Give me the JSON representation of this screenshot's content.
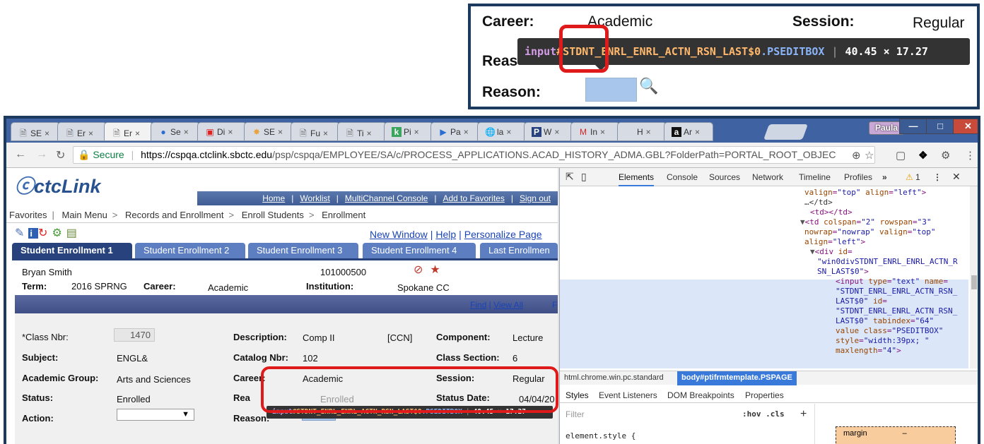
{
  "zoom": {
    "career_label": "Career:",
    "career_value": "Academic",
    "session_label": "Session:",
    "session_value": "Regular",
    "reason_label_top": "Reas",
    "reason_label": "Reason:",
    "tooltip": {
      "tag": "input",
      "id": "#STDNT_ENRL_ENRL_ACTN_RSN_LAST$0",
      "cls": ".PSEDITBOX",
      "size": "40.45 × 17.27"
    }
  },
  "browser": {
    "tabs": [
      {
        "icon": "page",
        "label": "SE"
      },
      {
        "icon": "page",
        "label": "Er"
      },
      {
        "icon": "page",
        "label": "Er"
      },
      {
        "icon": "blue-circle",
        "label": "Se"
      },
      {
        "icon": "red-box",
        "label": "Di"
      },
      {
        "icon": "multi",
        "label": "SE"
      },
      {
        "icon": "page",
        "label": "Fu"
      },
      {
        "icon": "page",
        "label": "Ti"
      },
      {
        "icon": "k",
        "label": "Pi"
      },
      {
        "icon": "p-arrow",
        "label": "Pa"
      },
      {
        "icon": "globe",
        "label": "la"
      },
      {
        "icon": "p-box",
        "label": "W"
      },
      {
        "icon": "m",
        "label": "In"
      },
      {
        "icon": "blank",
        "label": "H"
      },
      {
        "icon": "a",
        "label": "Ar"
      }
    ],
    "user": "Paula",
    "address": {
      "secure": "Secure",
      "host": "https://cspqa.ctclink.sbctc.edu",
      "path": "/psp/cspqa/EMPLOYEE/SA/c/PROCESS_APPLICATIONS.ACAD_HISTORY_ADMA.GBL?FolderPath=PORTAL_ROOT_OBJEC"
    }
  },
  "page": {
    "logo": "ctcLink",
    "topnav": [
      "Home",
      "Worklist",
      "MultiChannel Console",
      "Add to Favorites",
      "Sign out"
    ],
    "menubar": [
      "Favorites",
      "Main Menu",
      "Records and Enrollment",
      "Enroll Students",
      "Enrollment"
    ],
    "links": [
      "New Window",
      "Help",
      "Personalize Page"
    ],
    "tabs": [
      "Student Enrollment 1",
      "Student Enrollment 2",
      "Student Enrollment 3",
      "Student Enrollment 4",
      "Last Enrollmen"
    ],
    "student_name": "Bryan Smith",
    "student_id": "101000500",
    "term_label": "Term:",
    "term_value": "2016 SPRNG",
    "career_label": "Career:",
    "career_value": "Academic",
    "institution_label": "Institution:",
    "institution_value": "Spokane CC",
    "find": "Find",
    "view_all": "View All",
    "first": "Fi",
    "class_nbr_label": "*Class Nbr:",
    "class_nbr_value": "1470",
    "description_label": "Description:",
    "description_value": "Comp II",
    "ccn": "[CCN]",
    "component_label": "Component:",
    "component_value": "Lecture",
    "subject_label": "Subject:",
    "subject_value": "ENGL&",
    "catalog_label": "Catalog Nbr:",
    "catalog_value": "102",
    "section_label": "Class Section:",
    "section_value": "6",
    "acad_group_label": "Academic Group:",
    "acad_group_value": "Arts and Sciences",
    "career2_label": "Career:",
    "career2_value": "Academic",
    "session_label": "Session:",
    "session_value": "Regular",
    "status_label": "Status:",
    "status_value": "Enrolled",
    "reason_top_label": "Rea",
    "reason_top_value": "Enrolled",
    "status_date_label": "Status Date:",
    "status_date_value": "04/04/20",
    "action_label": "Action:",
    "reason_label": "Reason:",
    "tooltip": {
      "tag": "input",
      "id": "#STDNT_ENRL_ENRL_ACTN_RSN_LAST$0",
      "cls": ".PSEDITBOX",
      "size": "40.45 × 17.27"
    }
  },
  "devtools": {
    "tabs": [
      "Elements",
      "Console",
      "Sources",
      "Network",
      "Timeline",
      "Profiles"
    ],
    "warn_count": "1",
    "crumb_1": "html.chrome.win.pc.standard",
    "crumb_2": "body#ptifrmtemplate.PSPAGE",
    "styles_tabs": [
      "Styles",
      "Event Listeners",
      "DOM Breakpoints",
      "Properties"
    ],
    "filter_placeholder": "Filter",
    "hov": ":hov .cls",
    "element_style": "element.style {",
    "margin_label": "margin",
    "margin_value": "–"
  }
}
